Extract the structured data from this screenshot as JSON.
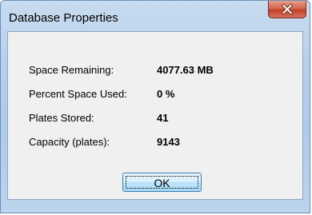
{
  "window": {
    "title": "Database Properties"
  },
  "title_bar": {
    "close_icon": "close-x-icon"
  },
  "properties": [
    {
      "label": "Space Remaining:",
      "value": "4077.63 MB"
    },
    {
      "label": "Percent Space Used:",
      "value": "0 %"
    },
    {
      "label": "Plates Stored:",
      "value": "41"
    },
    {
      "label": "Capacity (plates):",
      "value": "9143"
    }
  ],
  "buttons": {
    "ok_label": "OK"
  },
  "colors": {
    "close_button": "#c7412a",
    "ok_button_border": "#3c7fb1",
    "frame": "#b7d0ea"
  }
}
